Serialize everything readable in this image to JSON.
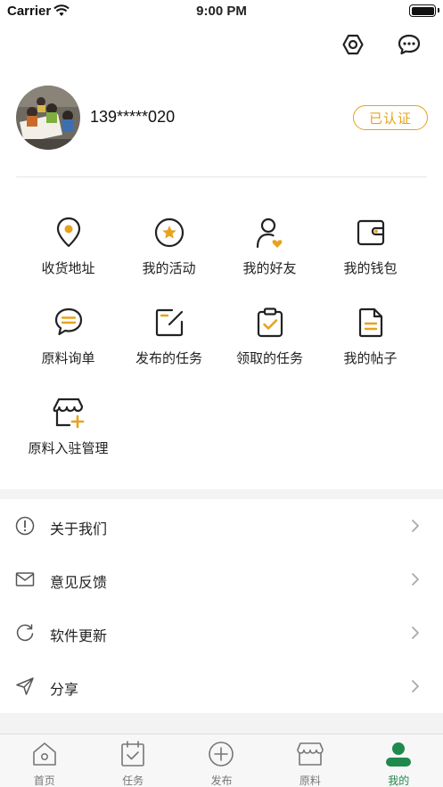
{
  "status_bar": {
    "carrier": "Carrier",
    "time": "9:00 PM"
  },
  "header": {
    "settings_icon": "settings-hex-icon",
    "message_icon": "message-bubble-icon"
  },
  "profile": {
    "phone": "139*****020",
    "verified_label": "已认证"
  },
  "grid_items": [
    {
      "label": "收货地址",
      "icon": "location-pin-icon"
    },
    {
      "label": "我的活动",
      "icon": "star-circle-icon"
    },
    {
      "label": "我的好友",
      "icon": "user-heart-icon"
    },
    {
      "label": "我的钱包",
      "icon": "wallet-icon"
    },
    {
      "label": "原料询单",
      "icon": "chat-lines-icon"
    },
    {
      "label": "发布的任务",
      "icon": "edit-square-icon"
    },
    {
      "label": "领取的任务",
      "icon": "clipboard-check-icon"
    },
    {
      "label": "我的帖子",
      "icon": "document-icon"
    },
    {
      "label": "原料入驻管理",
      "icon": "store-plus-icon"
    }
  ],
  "menu": [
    {
      "label": "关于我们",
      "icon": "info-circle-icon"
    },
    {
      "label": "意见反馈",
      "icon": "envelope-icon"
    },
    {
      "label": "软件更新",
      "icon": "refresh-icon"
    },
    {
      "label": "分享",
      "icon": "send-icon"
    }
  ],
  "tabs": [
    {
      "label": "首页",
      "icon": "home-icon"
    },
    {
      "label": "任务",
      "icon": "calendar-check-icon"
    },
    {
      "label": "发布",
      "icon": "plus-circle-icon"
    },
    {
      "label": "原料",
      "icon": "store-icon"
    },
    {
      "label": "我的",
      "icon": "user-filled-icon",
      "active": true
    }
  ],
  "colors": {
    "accent": "#e8a21c",
    "active_tab": "#1f8a4c",
    "icon_dark": "#222222"
  }
}
